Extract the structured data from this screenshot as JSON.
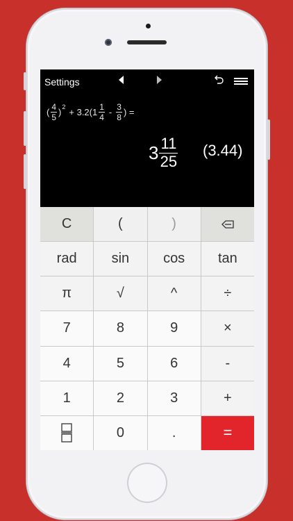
{
  "colors": {
    "background": "#c8302c",
    "equals_key": "#e2252b",
    "screen": "#000000"
  },
  "topbar": {
    "settings_label": "Settings",
    "icons": [
      "triangle-left-icon",
      "triangle-right-icon",
      "undo-icon",
      "menu-icon"
    ]
  },
  "expression": {
    "open_paren": "(",
    "frac1_num": "4",
    "frac1_den": "5",
    "close_paren": ")",
    "exponent": "2",
    "plus_part": "+ 3.2(1",
    "frac2_num": "1",
    "frac2_den": "4",
    "minus": "-",
    "frac3_num": "3",
    "frac3_den": "8",
    "tail": ") ="
  },
  "result": {
    "whole": "3",
    "numerator": "11",
    "denominator": "25",
    "decimal": "(3.44)"
  },
  "keys": {
    "clear": "C",
    "open_paren": "(",
    "close_paren": ")",
    "rad": "rad",
    "sin": "sin",
    "cos": "cos",
    "tan": "tan",
    "pi": "π",
    "sqrt": "√",
    "power": "^",
    "divide": "÷",
    "seven": "7",
    "eight": "8",
    "nine": "9",
    "multiply": "×",
    "four": "4",
    "five": "5",
    "six": "6",
    "minus": "-",
    "one": "1",
    "two": "2",
    "three": "3",
    "plus": "+",
    "zero": "0",
    "decimal_point": ".",
    "equals": "="
  }
}
